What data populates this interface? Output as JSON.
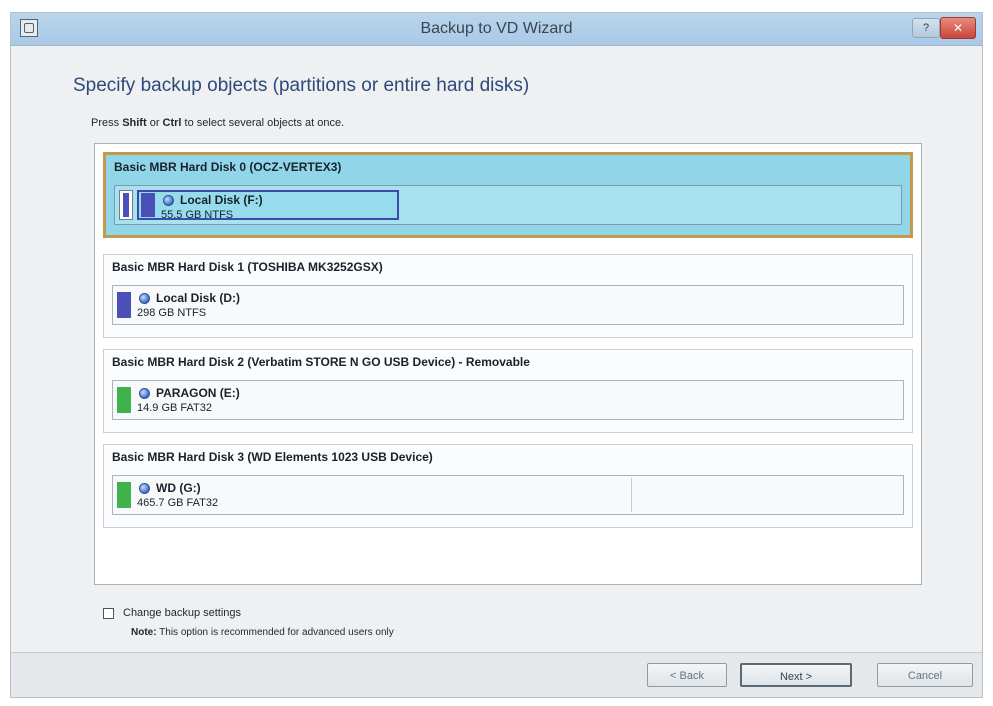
{
  "window": {
    "title": "Backup to VD Wizard",
    "help_label": "?",
    "close_label": "✕"
  },
  "heading": "Specify backup objects (partitions or entire hard disks)",
  "instruction": {
    "prefix": "Press ",
    "key1": "Shift",
    "middle": " or ",
    "key2": "Ctrl",
    "suffix": " to select several objects at once."
  },
  "disks": [
    {
      "header": "Basic MBR Hard Disk 0 (OCZ-VERTEX3)",
      "selected": true,
      "partition": {
        "name": "Local Disk (F:)",
        "size": "55.5 GB NTFS",
        "color": "#4b4fb8"
      }
    },
    {
      "header": "Basic MBR Hard Disk 1 (TOSHIBA MK3252GSX)",
      "selected": false,
      "partition": {
        "name": "Local Disk (D:)",
        "size": "298 GB NTFS",
        "color": "#4b4fb8"
      }
    },
    {
      "header": "Basic MBR Hard Disk 2 (Verbatim STORE N GO USB Device) - Removable",
      "selected": false,
      "partition": {
        "name": "PARAGON (E:)",
        "size": "14.9 GB FAT32",
        "color": "#3fb24b"
      }
    },
    {
      "header": "Basic MBR Hard Disk 3 (WD Elements 1023 USB Device)",
      "selected": false,
      "partition": {
        "name": "WD (G:)",
        "size": "465.7 GB FAT32",
        "color": "#3fb24b"
      }
    }
  ],
  "settings": {
    "change_backup_label": "Change backup settings",
    "checked": false,
    "note_label": "Note:",
    "note_text": " This option is recommended for advanced users only"
  },
  "buttons": {
    "back": "< Back",
    "next": "Next >",
    "cancel": "Cancel"
  }
}
